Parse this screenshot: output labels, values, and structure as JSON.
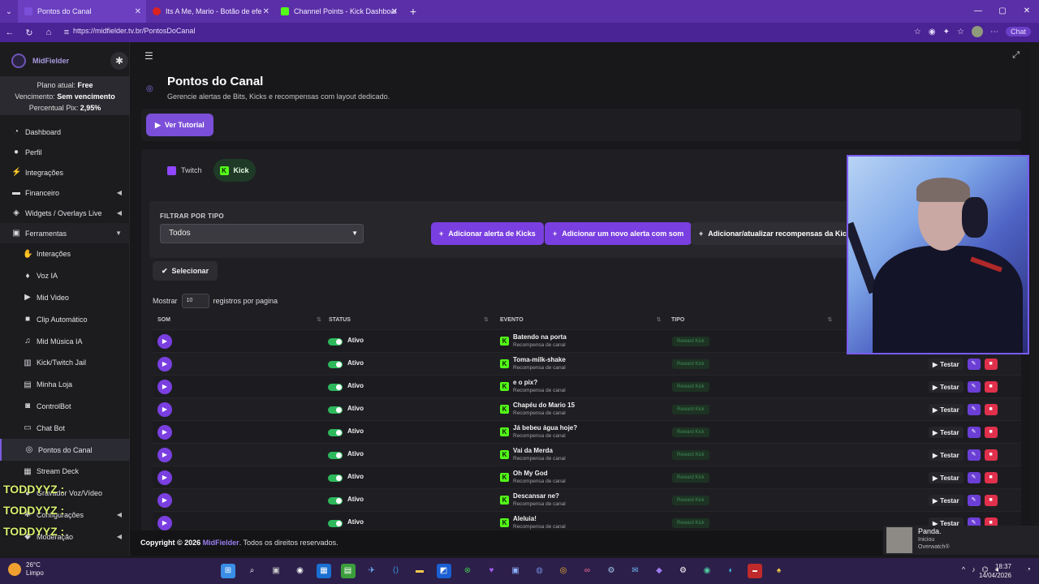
{
  "browser": {
    "tabs": [
      {
        "label": "Pontos do Canal",
        "color": "#7a4fd9"
      },
      {
        "label": "Its A Me, Mario - Botão de efeito :",
        "color": "#d22"
      },
      {
        "label": "Channel Points - Kick Dashboard",
        "color": "#53fc18"
      }
    ],
    "url": "https://midfielder.tv.br/PontosDoCanal",
    "chat_label": "Chat"
  },
  "sidebar": {
    "brand": "MidFielder",
    "plan_label": "Plano atual:",
    "plan_value": "Free",
    "expiry_label": "Vencimento:",
    "expiry_value": "Sem vencimento",
    "pix_label": "Percentual Pix:",
    "pix_value": "2,95%",
    "items": [
      {
        "label": "Dashboard",
        "icon": "gauge-icon"
      },
      {
        "label": "Perfil",
        "icon": "user-icon"
      },
      {
        "label": "Integrações",
        "icon": "plug-icon"
      },
      {
        "label": "Financeiro",
        "icon": "wallet-icon"
      },
      {
        "label": "Widgets / Overlays Live",
        "icon": "layers-icon"
      },
      {
        "label": "Ferramentas",
        "icon": "toolbox-icon"
      }
    ],
    "subitems": [
      {
        "label": "Interações",
        "icon": "hand-icon"
      },
      {
        "label": "Voz IA",
        "icon": "mic-icon"
      },
      {
        "label": "Mid Video",
        "icon": "video-icon"
      },
      {
        "label": "Clip Automático",
        "icon": "camera-icon"
      },
      {
        "label": "Mid Música IA",
        "icon": "music-icon"
      },
      {
        "label": "Kick/Twitch Jail",
        "icon": "jail-icon"
      },
      {
        "label": "Minha Loja",
        "icon": "store-icon"
      },
      {
        "label": "ControlBot",
        "icon": "robot-icon"
      },
      {
        "label": "Chat Bot",
        "icon": "chat-icon"
      },
      {
        "label": "Pontos do Canal",
        "icon": "coins-icon"
      },
      {
        "label": "Stream Deck",
        "icon": "keyboard-icon"
      },
      {
        "label": "Gravador Voz/Vídeo",
        "icon": "record-icon"
      },
      {
        "label": "Configurações",
        "icon": "cog-icon"
      },
      {
        "label": "Moderação",
        "icon": "shield-icon"
      }
    ],
    "chat_overlay": [
      "TODDYYZ :",
      "TODDYYZ :",
      "TODDYYZ :"
    ]
  },
  "page": {
    "title": "Pontos do Canal",
    "subtitle": "Gerencie alertas de Bits, Kicks e recompensas com layout dedicado.",
    "tutorial_button": "Ver Tutorial",
    "platform_tabs": [
      "Twitch",
      "Kick"
    ],
    "filter_label": "FILTRAR POR TIPO",
    "filter_value": "Todos",
    "buttons": {
      "add_kicks": "Adicionar alerta de Kicks",
      "add_sound": "Adicionar um novo alerta com som",
      "add_rewards": "Adicionar/atualizar recompensas da Kick"
    },
    "select_button": "Selecionar",
    "show_label": "Mostrar",
    "show_value": "10",
    "per_page_label": "registros por pagina",
    "columns": [
      "SOM",
      "STATUS",
      "EVENTO",
      "TIPO"
    ],
    "rows": [
      {
        "status": "Ativo",
        "event": "Batendo na porta",
        "sub": "Recompensa de canal",
        "type": "Reward Kick"
      },
      {
        "status": "Ativo",
        "event": "Toma-milk-shake",
        "sub": "Recompensa de canal",
        "type": "Reward Kick"
      },
      {
        "status": "Ativo",
        "event": "e o pix?",
        "sub": "Recompensa de canal",
        "type": "Reward Kick"
      },
      {
        "status": "Ativo",
        "event": "Chapéu do Mario 15",
        "sub": "Recompensa de canal",
        "type": "Reward Kick"
      },
      {
        "status": "Ativo",
        "event": "Já bebeu água hoje?",
        "sub": "Recompensa de canal",
        "type": "Reward Kick"
      },
      {
        "status": "Ativo",
        "event": "Vai da Merda",
        "sub": "Recompensa de canal",
        "type": "Reward Kick"
      },
      {
        "status": "Ativo",
        "event": "Oh My God",
        "sub": "Recompensa de canal",
        "type": "Reward Kick"
      },
      {
        "status": "Ativo",
        "event": "Descansar ne?",
        "sub": "Recompensa de canal",
        "type": "Reward Kick"
      },
      {
        "status": "Ativo",
        "event": "Aleluia!",
        "sub": "Recompensa de canal",
        "type": "Reward Kick"
      }
    ],
    "test_label": "Testar"
  },
  "footer": {
    "prefix": "Copyright © 2026",
    "brand": "MidFielder",
    "suffix": ". Todos os direitos reservados."
  },
  "notification": {
    "name": "Panda.",
    "line1": "Iniciou",
    "line2": "Overwatch®"
  },
  "taskbar": {
    "temp": "26°C",
    "weather": "Limpo",
    "time": "18:37",
    "date": "14/04/2026"
  }
}
